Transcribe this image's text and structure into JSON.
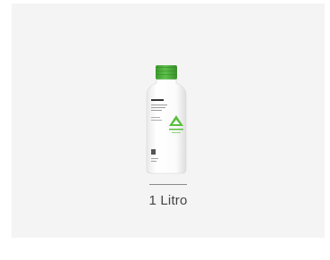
{
  "product": {
    "image_icon": "bottle-icon",
    "brand_logo_icon": "adama-logo-icon",
    "cap_color": "#4caf3a",
    "accent_color": "#5bbf3f"
  },
  "variant": {
    "size_label": "1 Litro"
  }
}
